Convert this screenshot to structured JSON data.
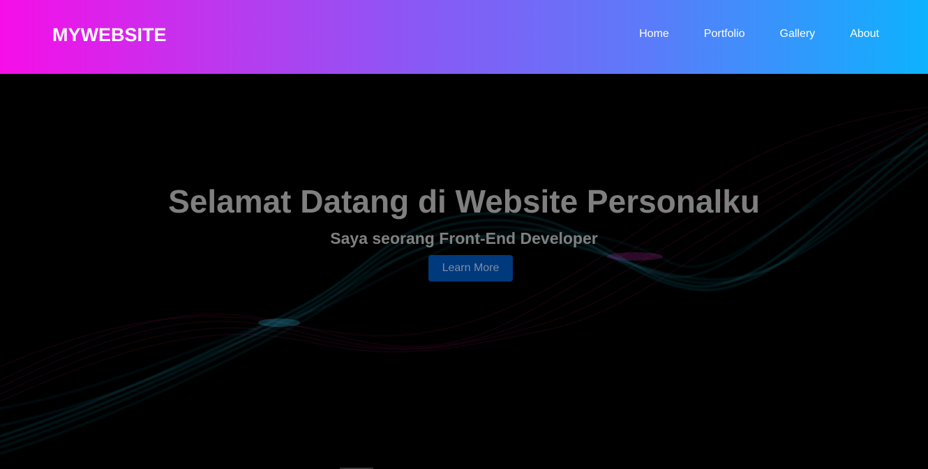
{
  "navbar": {
    "brand": "MYWEBSITE",
    "links": [
      "Home",
      "Portfolio",
      "Gallery",
      "About"
    ]
  },
  "hero": {
    "title": "Selamat Datang di Website Personalku",
    "subtitle": "Saya seorang Front-End Developer",
    "button_label": "Learn More"
  },
  "colors": {
    "gradient_start": "#f70ee8",
    "gradient_end": "#0db2fe",
    "background": "#000000",
    "button": "#01397d",
    "wave_cyan": "#1fa8c4",
    "wave_magenta": "#a0165e"
  }
}
